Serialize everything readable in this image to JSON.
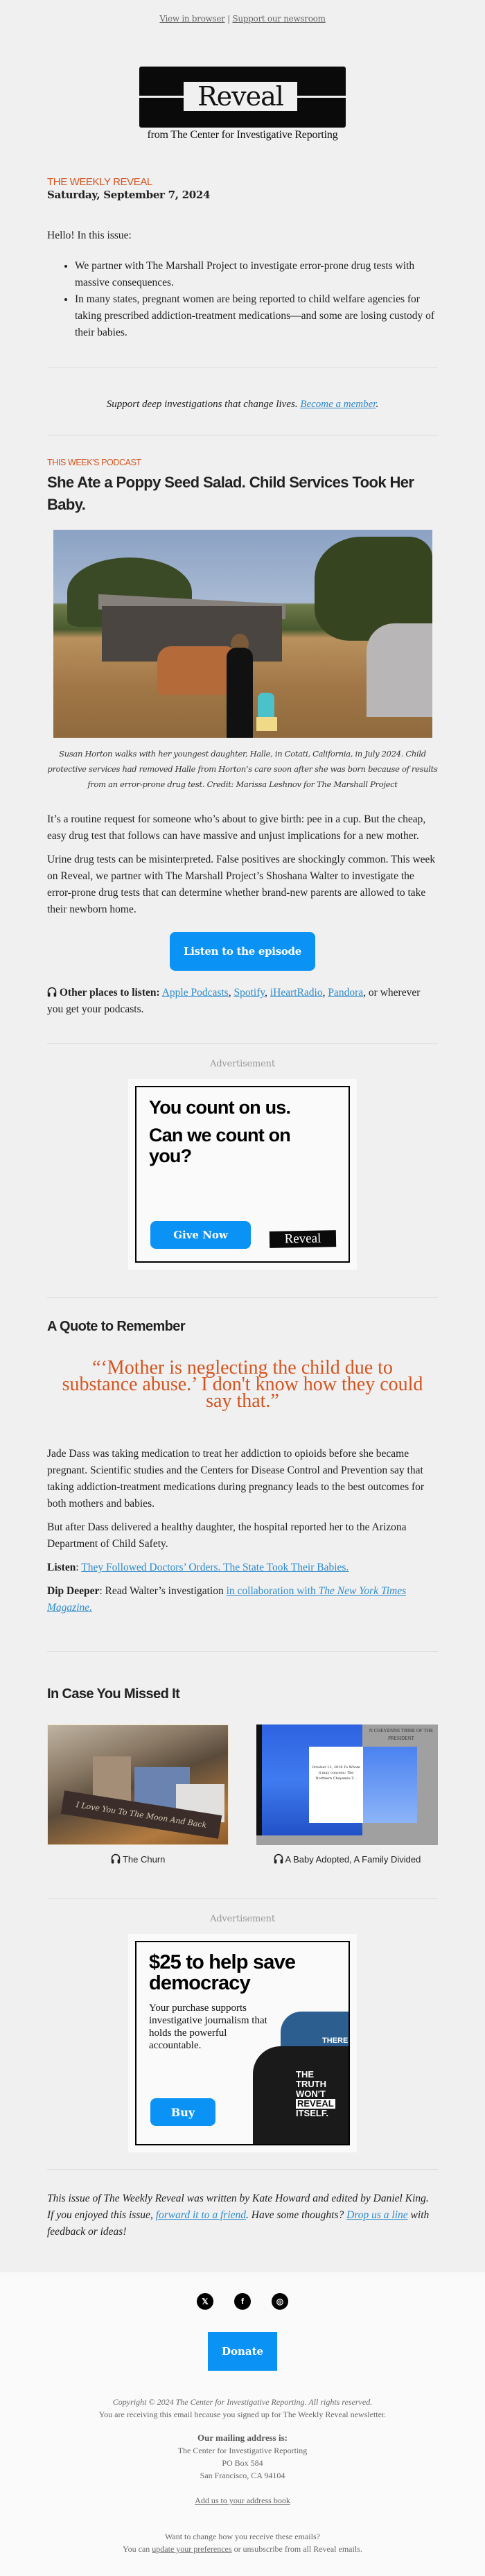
{
  "preheader": {
    "view_in_browser": "View in browser",
    "separator": "|",
    "support_newsroom": "Support our newsroom"
  },
  "logo": {
    "wordmark": "Reveal",
    "subtitle": "from The Center for Investigative Reporting"
  },
  "issue": {
    "kicker": "THE WEEKLY REVEAL",
    "date": "Saturday, September 7, 2024"
  },
  "intro": {
    "greeting": "Hello! In this issue:",
    "bullets": [
      "We partner with The Marshall Project to investigate error-prone drug tests with massive consequences.",
      "In many states, pregnant women are being reported to child welfare agencies for taking prescribed addiction-treatment medications—and some are losing custody of their babies."
    ]
  },
  "support": {
    "text": "Support deep investigations that change lives.",
    "link": "Become a member",
    "suffix": "."
  },
  "podcast": {
    "section_label": "THIS WEEK'S PODCAST",
    "headline": "She Ate a Poppy Seed Salad. Child Services Took Her Baby.",
    "caption": "Susan Horton walks with her youngest daughter, Halle, in Cotati, California, in July 2024. Child protective services had removed Halle from Horton’s care soon after she was born because of results from an error-prone drug test. Credit: Marissa Leshnov for The Marshall Project",
    "paragraphs": [
      "It’s a routine request for someone who’s about to give birth: pee in a cup. But the cheap, easy drug test that follows can have massive and unjust implications for a new mother.",
      "Urine drug tests can be misinterpreted. False positives are shockingly common. This week on Reveal, we partner with The Marshall Project’s Shoshana Walter to investigate the error-prone drug tests that can determine whether brand-new parents are allowed to take their newborn home."
    ],
    "listen_button": "Listen to the episode",
    "other_label": "Other places to listen:",
    "platforms": [
      "Apple Podcasts",
      "Spotify",
      "iHeartRadio",
      "Pandora"
    ],
    "other_suffix": ", or wherever you get your podcasts."
  },
  "ad1": {
    "label": "Advertisement",
    "line1": "You count on us.",
    "line2": "Can we count on you?",
    "button": "Give Now",
    "logo": "Reveal"
  },
  "quote_section": {
    "heading": "A Quote to Remember",
    "quote": "“‘Mother is neglecting the child due to substance abuse.’ I don't know how they could say that.”",
    "paragraphs": [
      "Jade Dass was taking medication to treat her addiction to opioids before she became pregnant. Scientific studies and the Centers for Disease Control and Prevention say that taking addiction-treatment medications during pregnancy leads to the best outcomes for both mothers and babies.",
      "But after Dass delivered a healthy daughter, the hospital reported her to the Arizona Department of Child Safety."
    ],
    "listen_label": "Listen",
    "listen_link": "They Followed Doctors’ Orders. The State Took Their Babies.",
    "deeper_label": "Dip Deeper",
    "deeper_text": "Read Walter’s investigation",
    "deeper_link": "in collaboration with ",
    "deeper_link_italic": "The New York Times Magazine."
  },
  "icymi": {
    "heading": "In Case You Missed It",
    "items": [
      {
        "title": "The Churn",
        "thumb_text": "I Love You To The Moon And Back"
      },
      {
        "title": "A Baby Adopted, A Family Divided",
        "thumb_header": "N CHEYENNE TRIBE OF THE PRESIDENT",
        "thumb_letter": "October 12, 2018 To Whom it may concern: The Northern Cheyenne T..."
      }
    ]
  },
  "ad2": {
    "label": "Advertisement",
    "headline": "$25 to help save democracy",
    "body": "Your purchase supports investigative journalism that holds the powerful accountable.",
    "button": "Buy",
    "shirt_blue_text": "THERE",
    "shirt_black_lines": [
      "THE",
      "TRUTH",
      "WON'T",
      "REVEAL",
      "ITSELF."
    ]
  },
  "signoff": {
    "part1": "This issue of The Weekly Reveal was written by Kate Howard and edited by Daniel King. If you enjoyed this issue, ",
    "forward_link": "forward it to a friend",
    "part2": ". Have some thoughts? ",
    "drop_link": "Drop us a line",
    "part3": " with feedback or ideas!"
  },
  "footer": {
    "socials": [
      {
        "name": "x-icon",
        "glyph": "𝕏"
      },
      {
        "name": "facebook-icon",
        "glyph": "f"
      },
      {
        "name": "instagram-icon",
        "glyph": "◎"
      }
    ],
    "donate": "Donate",
    "copyright": "Copyright © 2024 The Center for Investigative Reporting. All rights reserved.",
    "reason": "You are receiving this email because you signed up for The Weekly Reveal newsletter.",
    "address_label": "Our mailing address is:",
    "address_lines": [
      "The Center for Investigative Reporting",
      "PO Box 584",
      "San Francisco, CA 94104"
    ],
    "add_address_book": "Add us to your address book",
    "change_q": "Want to change how you receive these emails?",
    "change_pre": "You can ",
    "update_prefs": "update your preferences",
    "change_post": " or unsubscribe from all Reveal emails."
  }
}
